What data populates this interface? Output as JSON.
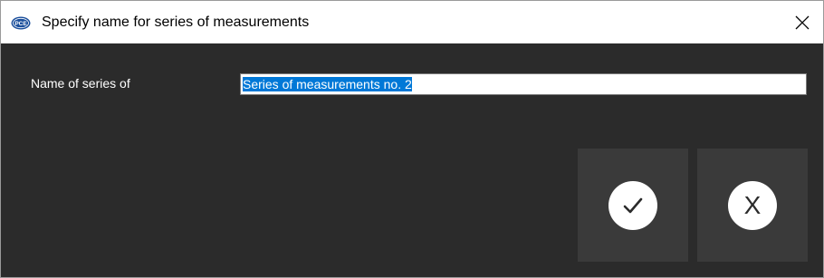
{
  "window": {
    "title": "Specify name for series of measurements",
    "logo_text": "PCE",
    "close_symbol": "✕"
  },
  "form": {
    "label": "Name of series of",
    "input_value": "Series of measurements no. 2"
  },
  "buttons": {
    "ok_icon": "checkmark-icon",
    "cancel_label": "X"
  },
  "colors": {
    "background": "#2b2b2b",
    "button_background": "#3a3a3a",
    "selection": "#0078d7",
    "logo": "#1b4f9c"
  }
}
